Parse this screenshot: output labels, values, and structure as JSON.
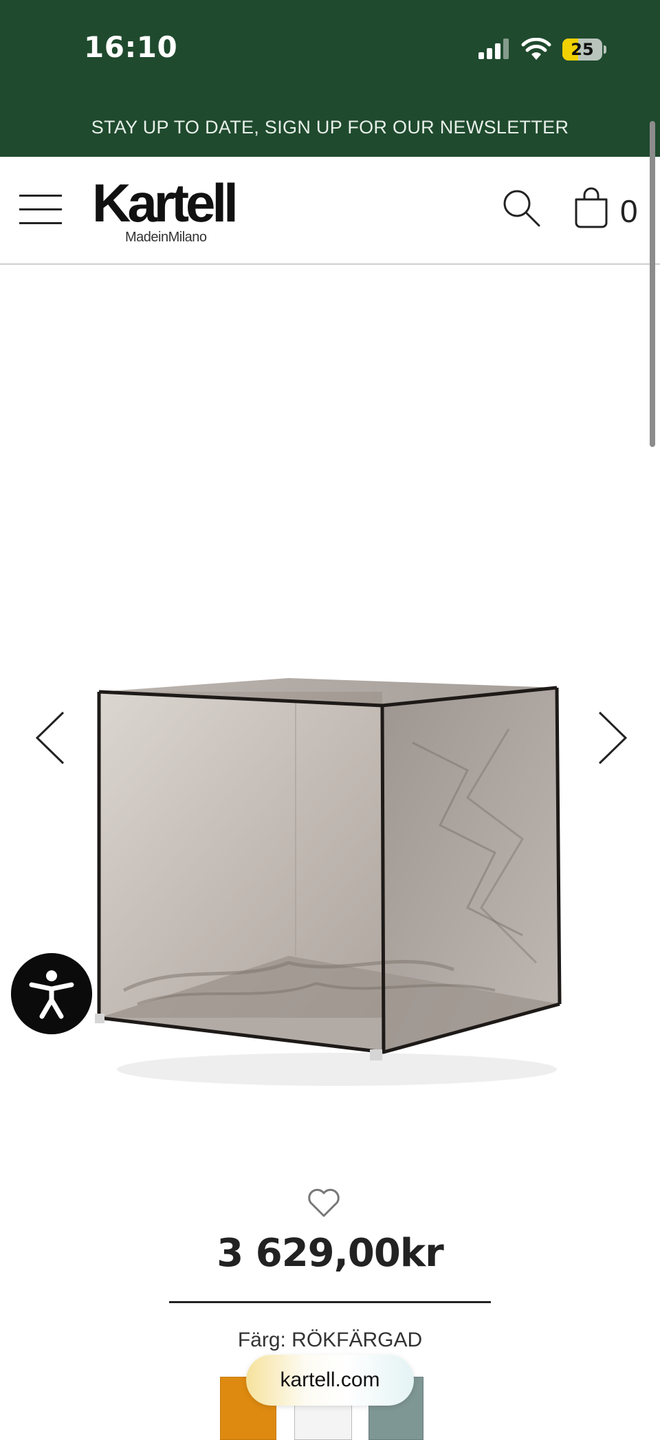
{
  "status_bar": {
    "time": "16:10",
    "battery": "25"
  },
  "newsletter": {
    "text": "STAY UP TO DATE, SIGN UP FOR OUR NEWSLETTER"
  },
  "header": {
    "logo": "Kartell",
    "logo_sub": "MadeinMilano",
    "cart_count": "0",
    "icons": [
      "hamburger-menu-icon",
      "search-icon",
      "shopping-bag-icon"
    ]
  },
  "gallery": {
    "image": "transparent smoke-colored cube container",
    "icons": [
      "chevron-left-icon",
      "chevron-right-icon"
    ]
  },
  "accessibility": {
    "icon": "accessibility-person-icon"
  },
  "product": {
    "price": "3 629,00kr",
    "color_label": "Färg: RÖKFÄRGAD",
    "swatches": [
      "#de8a10",
      "#f4f4f4",
      "#7e9694"
    ]
  },
  "browser": {
    "url": "kartell.com"
  },
  "colors": {
    "brand_green": "#1f4a2e",
    "text": "#222222"
  }
}
